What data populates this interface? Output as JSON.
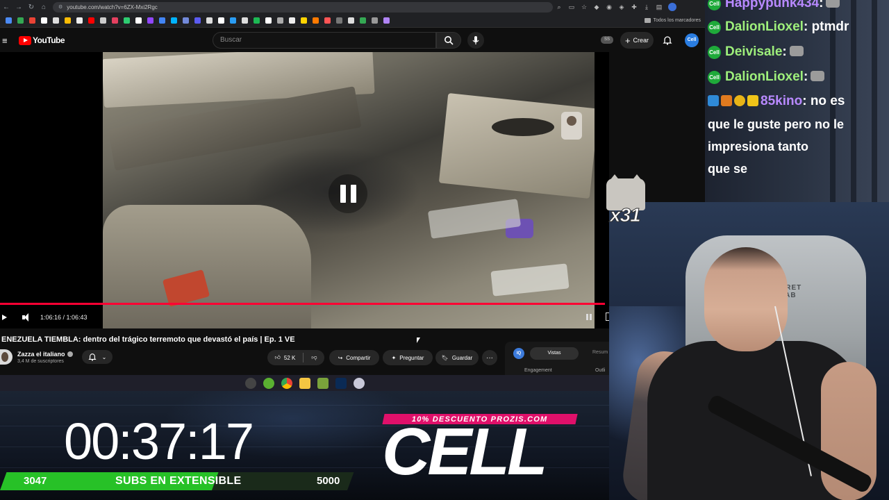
{
  "browser": {
    "url": "youtube.com/watch?v=6ZX-Mxi2Rgc",
    "bookmarks_folder_label": "Todos los marcadores"
  },
  "youtube": {
    "logo_text": "YouTube",
    "search_placeholder": "Buscar",
    "ss_chip": "SS",
    "create_label": "Crear",
    "avatar_text": "Cell",
    "player": {
      "time_readout": "1:06:16 / 1:06:43",
      "progress_fraction": 0.993
    },
    "video_title": "ENEZUELA TIEMBLA: dentro del trágico terremoto que devastó el país | Ep. 1 VE",
    "channel_name": "Zazza el italiano",
    "subscribers": "3,4 M de suscriptores",
    "like_count": "52 K",
    "share_label": "Compartir",
    "ask_label": "Preguntar",
    "save_label": "Guardar",
    "more_label": "···",
    "side_panel": {
      "badge": "IQ",
      "tab_views": "Vistas",
      "tab_summary": "Resum",
      "engagement": "Engagement",
      "outline": "Outli"
    }
  },
  "overlay": {
    "timer": "00:37:17",
    "subs_current": "3047",
    "subs_label": "SUBS EN EXTENSIBLE",
    "subs_goal": "5000",
    "subs_progress_fraction": 0.609,
    "promo_banner": "10% DESCUENTO PROZIS.COM",
    "cell_logo": "CELL",
    "cat_count": "x31"
  },
  "chat": {
    "badge_text": "Cell",
    "messages": [
      {
        "user": "Happypunk434",
        "colon": ":",
        "emote": "cat-emote"
      },
      {
        "user": "DalionLioxel",
        "colon": ":",
        "text": "ptmdr"
      },
      {
        "user": "Deivisale",
        "colon": ":",
        "emote": "cat-emote"
      },
      {
        "user": "DalionLioxel",
        "colon": ":",
        "emote": "cat-emote"
      },
      {
        "user": "85kino",
        "colon": ":",
        "text": "no es que le guste pero no le impresiona tanto que se"
      }
    ],
    "wrapped_lines": [
      "que le guste pero no le",
      "impresiona tanto",
      "que se"
    ]
  },
  "webcam": {
    "chair_text": "CRET\nLAB"
  },
  "colors": {
    "youtube_red": "#ff0000",
    "progress_red": "#ff0033",
    "chat_name_green": "#9eef7b",
    "chat_name_purple": "#b889ff",
    "sub_bar_green": "#27c127",
    "promo_pink": "#e0106a"
  }
}
